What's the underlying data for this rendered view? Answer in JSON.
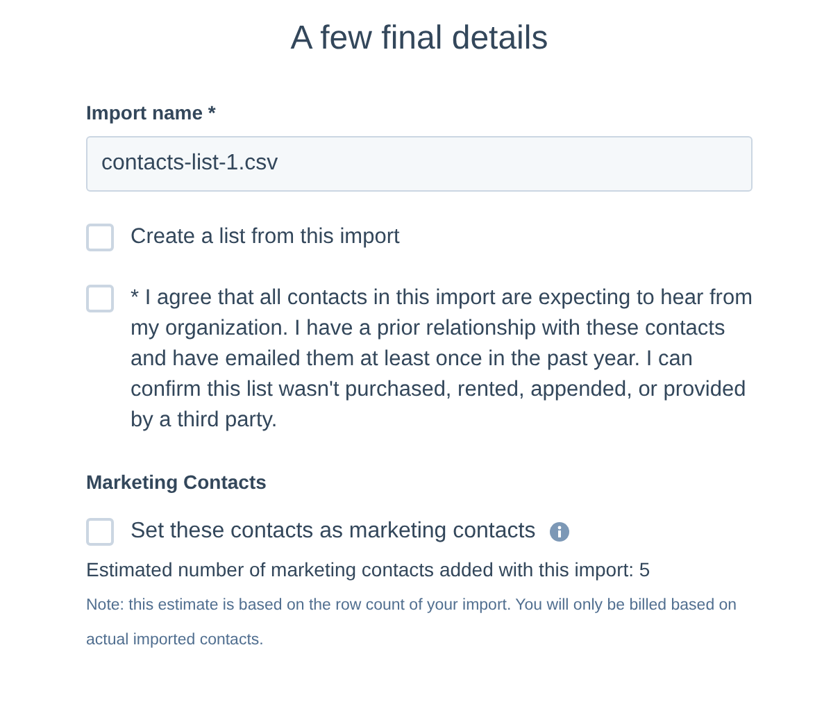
{
  "title": "A few final details",
  "import_name": {
    "label": "Import name *",
    "value": "contacts-list-1.csv"
  },
  "options": [
    {
      "label": "Create a list from this import",
      "checked": false
    },
    {
      "label": "* I agree that all contacts in this import are expecting to hear from my organization. I have a prior relationship with these contacts and have emailed them at least once in the past year. I can confirm this list wasn't purchased, rented, appended, or provided by a third party.",
      "checked": false
    }
  ],
  "marketing": {
    "heading": "Marketing Contacts",
    "option": {
      "label": "Set these contacts as marketing contacts",
      "checked": false
    },
    "estimate": "Estimated number of marketing contacts added with this import: 5",
    "note": "Note: this estimate is based on the row count of your import. You will only be billed based on actual imported contacts."
  }
}
